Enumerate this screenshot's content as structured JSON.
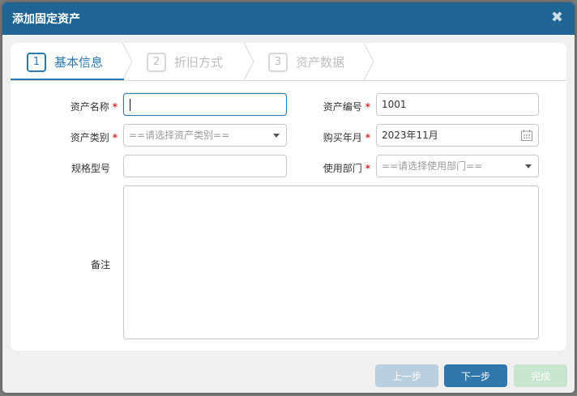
{
  "dialog": {
    "title": "添加固定资产",
    "close_glyph": "✖"
  },
  "steps": [
    {
      "num": "1",
      "label": "基本信息",
      "state": "active"
    },
    {
      "num": "2",
      "label": "折旧方式",
      "state": "inactive"
    },
    {
      "num": "3",
      "label": "资产数据",
      "state": "inactive"
    }
  ],
  "form": {
    "asset_name": {
      "label": "资产名称",
      "value": ""
    },
    "asset_code": {
      "label": "资产编号",
      "value": "1001"
    },
    "asset_category": {
      "label": "资产类别",
      "placeholder": "==请选择资产类别=="
    },
    "purchase_month": {
      "label": "购买年月",
      "value": "2023年11月"
    },
    "spec_model": {
      "label": "规格型号",
      "value": ""
    },
    "department": {
      "label": "使用部门",
      "placeholder": "==请选择使用部门=="
    },
    "remarks": {
      "label": "备注",
      "value": ""
    },
    "required_mark": "*"
  },
  "buttons": {
    "prev": "上一步",
    "next": "下一步",
    "done": "完成"
  },
  "colors": {
    "titlebar": "#1e6593",
    "accent": "#2a79b1",
    "required": "#d0342c"
  }
}
